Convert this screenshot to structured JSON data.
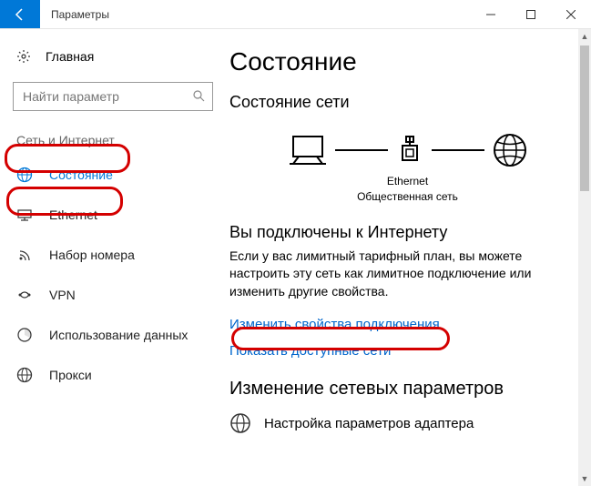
{
  "window": {
    "title": "Параметры"
  },
  "sidebar": {
    "home_label": "Главная",
    "search_placeholder": "Найти параметр",
    "category": "Сеть и Интернет",
    "items": [
      {
        "label": "Состояние"
      },
      {
        "label": "Ethernet"
      },
      {
        "label": "Набор номера"
      },
      {
        "label": "VPN"
      },
      {
        "label": "Использование данных"
      },
      {
        "label": "Прокси"
      }
    ]
  },
  "main": {
    "heading": "Состояние",
    "network_status_heading": "Состояние сети",
    "diagram": {
      "conn_type": "Ethernet",
      "network_profile": "Общественная сеть"
    },
    "connected_heading": "Вы подключены к Интернету",
    "connected_desc": "Если у вас лимитный тарифный план, вы можете настроить эту сеть как лимитное подключение или изменить другие свойства.",
    "link_change_props": "Изменить свойства подключения",
    "link_show_networks": "Показать доступные сети",
    "change_params_heading": "Изменение сетевых параметров",
    "adapter_label": "Настройка параметров адаптера"
  }
}
